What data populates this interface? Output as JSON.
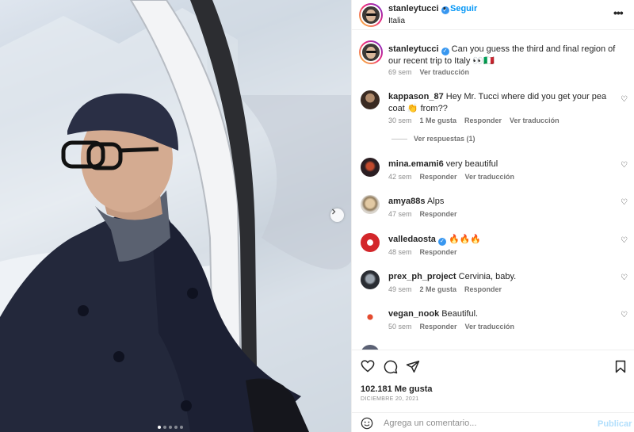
{
  "post": {
    "username": "stanleytucci",
    "follow_label": "Seguir",
    "separator": "•",
    "location": "Italia",
    "more_icon": "more-horizontal-icon",
    "carousel": {
      "slide_count": 5,
      "active_index": 0
    }
  },
  "caption": {
    "username": "stanleytucci",
    "text": "Can you guess the third and final region of our recent trip to Italy 👀🇮🇹",
    "time": "69 sem",
    "translate_label": "Ver traducción"
  },
  "comments": [
    {
      "username": "kappason_87",
      "text": "Hey Mr. Tucci where did you get your pea coat 👏 from??",
      "time": "30 sem",
      "likes": "1 Me gusta",
      "reply": "Responder",
      "translate": "Ver traducción",
      "verified": false
    },
    {
      "username": "mina.emami6",
      "text": "very beautiful",
      "time": "42 sem",
      "reply": "Responder",
      "translate": "Ver traducción",
      "verified": false
    },
    {
      "username": "amya88s",
      "text": "Alps",
      "time": "47 sem",
      "reply": "Responder",
      "verified": false
    },
    {
      "username": "valledaosta",
      "text": "🔥🔥🔥",
      "time": "48 sem",
      "reply": "Responder",
      "verified": true
    },
    {
      "username": "prex_ph_project",
      "text": "Cervinia, baby.",
      "time": "49 sem",
      "likes": "2 Me gusta",
      "reply": "Responder",
      "verified": false
    },
    {
      "username": "vegan_nook",
      "text": "Beautiful.",
      "time": "50 sem",
      "reply": "Responder",
      "translate": "Ver traducción",
      "verified": false
    }
  ],
  "view_replies": "Ver respuestas (1)",
  "footer": {
    "likes": "102.181 Me gusta",
    "date": "DICIEMBRE 20, 2021",
    "comment_placeholder": "Agrega un comentario...",
    "publish_label": "Publicar"
  },
  "colors": {
    "accent": "#0095f6",
    "verified": "#3897f0",
    "publish_disabled": "#b2dffc"
  }
}
